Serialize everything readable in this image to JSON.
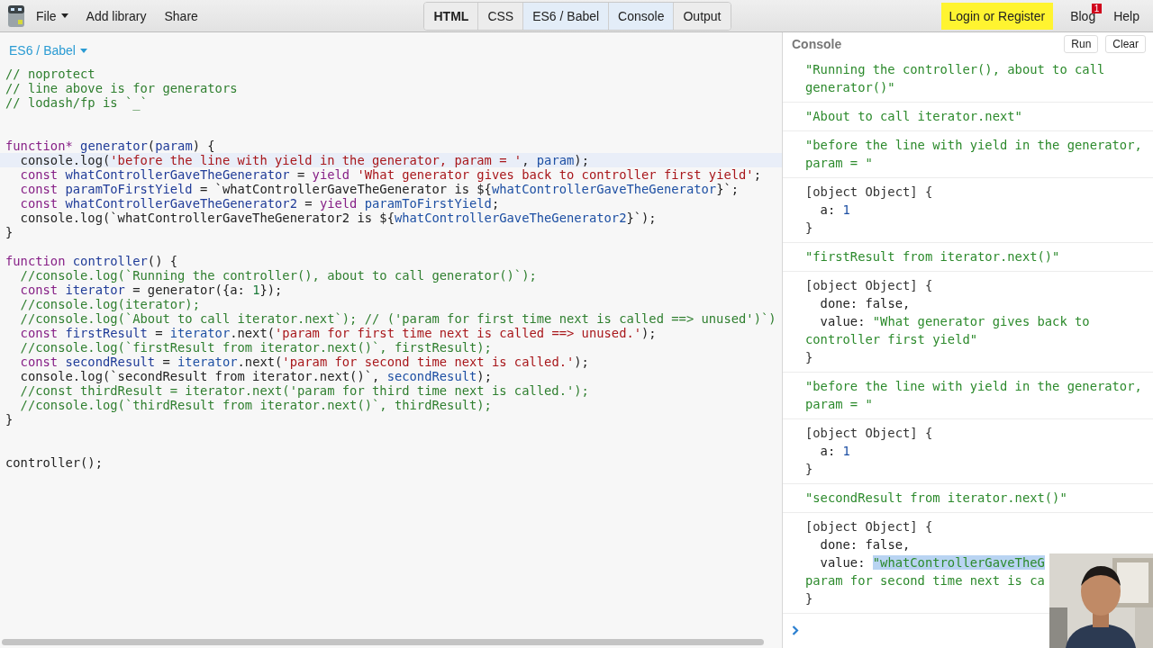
{
  "topbar": {
    "menu": [
      {
        "label": "File",
        "dropdown": true
      },
      {
        "label": "Add library",
        "dropdown": false
      },
      {
        "label": "Share",
        "dropdown": false
      }
    ],
    "panels": [
      {
        "label": "HTML",
        "selected": false,
        "bold": true
      },
      {
        "label": "CSS",
        "selected": false,
        "bold": false
      },
      {
        "label": "ES6 / Babel",
        "selected": true,
        "bold": false
      },
      {
        "label": "Console",
        "selected": true,
        "bold": false
      },
      {
        "label": "Output",
        "selected": false,
        "bold": false
      }
    ],
    "right": [
      {
        "label": "Login or Register",
        "kind": "highlight"
      },
      {
        "label": "Blog",
        "kind": "badge",
        "badge": "1"
      },
      {
        "label": "Help",
        "kind": "plain"
      }
    ]
  },
  "editor": {
    "language": "ES6 / Babel",
    "lines": [
      {
        "active": false,
        "tokens": [
          {
            "kind": "comment",
            "text": "// noprotect"
          }
        ]
      },
      {
        "active": false,
        "tokens": [
          {
            "kind": "comment",
            "text": "// line above is for generators"
          }
        ]
      },
      {
        "active": false,
        "tokens": [
          {
            "kind": "comment",
            "text": "// lodash/fp is `_`"
          }
        ]
      },
      {
        "active": false
      },
      {
        "active": false
      },
      {
        "active": false,
        "tokens": [
          {
            "kind": "keyword",
            "text": "function* "
          },
          {
            "kind": "def",
            "text": "generator"
          },
          {
            "kind": "plain",
            "text": "("
          },
          {
            "kind": "def",
            "text": "param"
          },
          {
            "kind": "plain",
            "text": ") {"
          }
        ]
      },
      {
        "active": true,
        "tokens": [
          {
            "kind": "plain",
            "text": "  console.log("
          },
          {
            "kind": "string",
            "text": "'before the line with yield in the generator, param = '"
          },
          {
            "kind": "plain",
            "text": ", "
          },
          {
            "kind": "variable",
            "text": "param"
          },
          {
            "kind": "plain",
            "text": ");"
          }
        ]
      },
      {
        "active": false,
        "tokens": [
          {
            "kind": "keyword",
            "text": "  const "
          },
          {
            "kind": "def",
            "text": "whatControllerGaveTheGenerator"
          },
          {
            "kind": "plain",
            "text": " = "
          },
          {
            "kind": "keyword",
            "text": "yield "
          },
          {
            "kind": "string",
            "text": "'What generator gives back to controller first yield'"
          },
          {
            "kind": "plain",
            "text": ";"
          }
        ]
      },
      {
        "active": false,
        "tokens": [
          {
            "kind": "keyword",
            "text": "  const "
          },
          {
            "kind": "def",
            "text": "paramToFirstYield"
          },
          {
            "kind": "plain",
            "text": " = `whatControllerGaveTheGenerator is ${"
          },
          {
            "kind": "variable",
            "text": "whatControllerGaveTheGenerator"
          },
          {
            "kind": "plain",
            "text": "}`;"
          }
        ]
      },
      {
        "active": false,
        "tokens": [
          {
            "kind": "keyword",
            "text": "  const "
          },
          {
            "kind": "def",
            "text": "whatControllerGaveTheGenerator2"
          },
          {
            "kind": "plain",
            "text": " = "
          },
          {
            "kind": "keyword",
            "text": "yield "
          },
          {
            "kind": "variable",
            "text": "paramToFirstYield"
          },
          {
            "kind": "plain",
            "text": ";"
          }
        ]
      },
      {
        "active": false,
        "tokens": [
          {
            "kind": "plain",
            "text": "  console.log(`whatControllerGaveTheGenerator2 is ${"
          },
          {
            "kind": "variable",
            "text": "whatControllerGaveTheGenerator2"
          },
          {
            "kind": "plain",
            "text": "}`);"
          }
        ]
      },
      {
        "active": false,
        "tokens": [
          {
            "kind": "plain",
            "text": "}"
          }
        ]
      },
      {
        "active": false
      },
      {
        "active": false,
        "tokens": [
          {
            "kind": "keyword",
            "text": "function "
          },
          {
            "kind": "def",
            "text": "controller"
          },
          {
            "kind": "plain",
            "text": "() {"
          }
        ]
      },
      {
        "active": false,
        "tokens": [
          {
            "kind": "comment",
            "text": "  //console.log(`Running the controller(), about to call generator()`);"
          }
        ]
      },
      {
        "active": false,
        "tokens": [
          {
            "kind": "keyword",
            "text": "  const "
          },
          {
            "kind": "def",
            "text": "iterator"
          },
          {
            "kind": "plain",
            "text": " = generator({a: "
          },
          {
            "kind": "number",
            "text": "1"
          },
          {
            "kind": "plain",
            "text": "});"
          }
        ]
      },
      {
        "active": false,
        "tokens": [
          {
            "kind": "comment",
            "text": "  //console.log(iterator);"
          }
        ]
      },
      {
        "active": false,
        "tokens": [
          {
            "kind": "comment",
            "text": "  //console.log(`About to call iterator.next`); // ('param for first time next is called ==> unused')`)"
          }
        ]
      },
      {
        "active": false,
        "tokens": [
          {
            "kind": "keyword",
            "text": "  const "
          },
          {
            "kind": "def",
            "text": "firstResult"
          },
          {
            "kind": "plain",
            "text": " = "
          },
          {
            "kind": "variable",
            "text": "iterator"
          },
          {
            "kind": "plain",
            "text": ".next("
          },
          {
            "kind": "string",
            "text": "'param for first time next is called ==> unused.'"
          },
          {
            "kind": "plain",
            "text": ");"
          }
        ]
      },
      {
        "active": false,
        "tokens": [
          {
            "kind": "comment",
            "text": "  //console.log(`firstResult from iterator.next()`, firstResult);"
          }
        ]
      },
      {
        "active": false,
        "tokens": [
          {
            "kind": "keyword",
            "text": "  const "
          },
          {
            "kind": "def",
            "text": "secondResult"
          },
          {
            "kind": "plain",
            "text": " = "
          },
          {
            "kind": "variable",
            "text": "iterator"
          },
          {
            "kind": "plain",
            "text": ".next("
          },
          {
            "kind": "string",
            "text": "'param for second time next is called.'"
          },
          {
            "kind": "plain",
            "text": ");"
          }
        ]
      },
      {
        "active": false,
        "tokens": [
          {
            "kind": "plain",
            "text": "  console.log(`secondResult from iterator.next()`, "
          },
          {
            "kind": "variable",
            "text": "secondResult"
          },
          {
            "kind": "plain",
            "text": ");"
          }
        ]
      },
      {
        "active": false,
        "tokens": [
          {
            "kind": "comment",
            "text": "  //const thirdResult = iterator.next('param for third time next is called.');"
          }
        ]
      },
      {
        "active": false,
        "tokens": [
          {
            "kind": "comment",
            "text": "  //console.log(`thirdResult from iterator.next()`, thirdResult);"
          }
        ]
      },
      {
        "active": false,
        "tokens": [
          {
            "kind": "plain",
            "text": "}"
          }
        ]
      },
      {
        "active": false
      },
      {
        "active": false
      },
      {
        "active": false,
        "tokens": [
          {
            "kind": "plain",
            "text": "controller();"
          }
        ]
      }
    ]
  },
  "console": {
    "title": "Console",
    "buttons": [
      "Run",
      "Clear"
    ],
    "entries": [
      {
        "kind": "string",
        "text": "\"Running the controller(), about to call generator()\""
      },
      {
        "kind": "string",
        "text": "\"About to call iterator.next\""
      },
      {
        "kind": "string",
        "text": "\"before the line with yield in the generator, param = \""
      },
      {
        "kind": "object",
        "header": "[object Object] {",
        "close": "}",
        "properties": [
          {
            "key": "a:",
            "value": "1",
            "kind": "number",
            "highlighted": false
          }
        ]
      },
      {
        "kind": "string",
        "text": "\"firstResult from iterator.next()\""
      },
      {
        "kind": "object",
        "header": "[object Object] {",
        "close": "}",
        "properties": [
          {
            "key": "done:",
            "value": "false,",
            "kind": "boolean",
            "highlighted": false
          },
          {
            "key": "value:",
            "value": "\"What generator gives back to controller first yield\"",
            "kind": "string",
            "highlighted": false
          }
        ]
      },
      {
        "kind": "string",
        "text": "\"before the line with yield in the generator, param = \""
      },
      {
        "kind": "object",
        "header": "[object Object] {",
        "close": "}",
        "properties": [
          {
            "key": "a:",
            "value": "1",
            "kind": "number",
            "highlighted": false
          }
        ]
      },
      {
        "kind": "string",
        "text": "\"secondResult from iterator.next()\""
      },
      {
        "kind": "object",
        "header": "[object Object] {",
        "close": "}",
        "properties": [
          {
            "key": "done:",
            "value": "false,",
            "kind": "boolean",
            "highlighted": false
          },
          {
            "key": "value:",
            "value": "\"whatControllerGaveTheG",
            "kind": "string",
            "highlighted": true,
            "continuation": "param for second time next is ca"
          }
        ]
      }
    ]
  }
}
